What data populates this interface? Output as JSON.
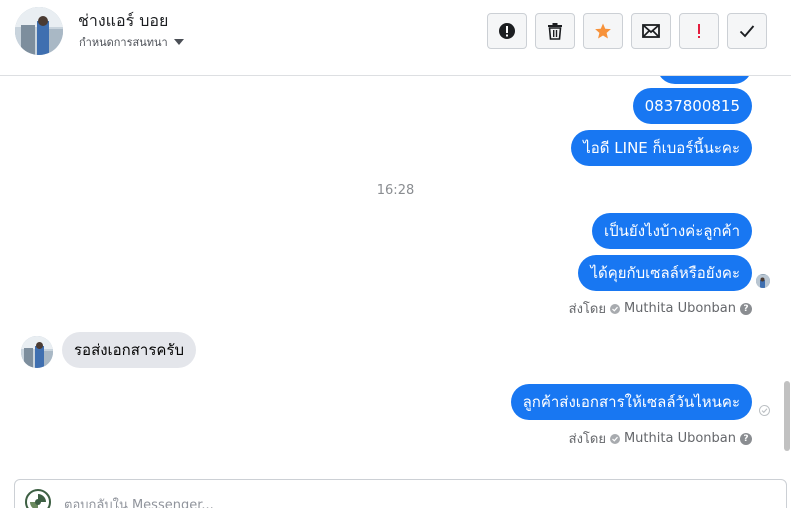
{
  "header": {
    "name": "ช่างแอร์ บอย",
    "subtitle": "กำหนดการสนทนา",
    "actions": [
      {
        "name": "spam-button",
        "icon": "alert-circle-icon"
      },
      {
        "name": "delete-button",
        "icon": "trash-icon"
      },
      {
        "name": "star-button",
        "icon": "star-icon",
        "color": "#f7923a"
      },
      {
        "name": "mark-unread-button",
        "icon": "envelope-icon"
      },
      {
        "name": "follow-up-button",
        "icon": "exclamation-icon",
        "color": "#e41e3f"
      },
      {
        "name": "mark-done-button",
        "icon": "check-icon"
      }
    ]
  },
  "thread": {
    "messages_top": [
      {
        "text": "0837800815"
      },
      {
        "text": "ไอดี LINE ก็เบอร์นี้นะคะ"
      }
    ],
    "timestamp": "16:28",
    "messages_mid": [
      {
        "text": "เป็นยังไงบ้างค่ะลูกค้า"
      },
      {
        "text": "ได้คุยกับเซลล์หรือยังคะ"
      }
    ],
    "sent_by_1": {
      "prefix": "ส่งโดย",
      "name": "Muthita Ubonban",
      "help": "?"
    },
    "incoming": {
      "text": "รอส่งเอกสารครับ"
    },
    "last_outgoing": {
      "text": "ลูกค้าส่งเอกสารให้เซลล์วันไหนคะ"
    },
    "sent_by_2": {
      "prefix": "ส่งโดย",
      "name": "Muthita Ubonban",
      "help": "?"
    }
  },
  "composer": {
    "placeholder": "ตอบกลับใน Messenger..."
  },
  "colors": {
    "accent": "#1877f2",
    "incoming_bubble": "#e4e6eb",
    "star": "#f7923a",
    "flag": "#e41e3f"
  }
}
